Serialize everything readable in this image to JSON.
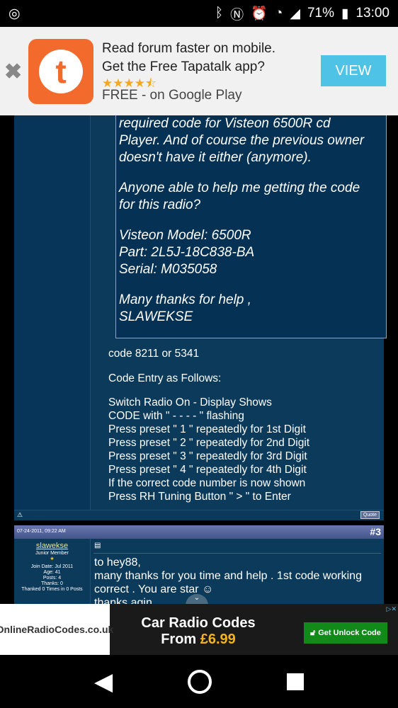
{
  "status": {
    "battery": "71%",
    "time": "13:00",
    "icons": [
      "instagram-icon",
      "bluetooth-icon",
      "nfc-icon",
      "alarm-icon",
      "wifi-icon",
      "signal-icon",
      "battery-icon"
    ]
  },
  "banner": {
    "line1": "Read forum faster on mobile.",
    "line2": "Get the Free Tapatalk app?",
    "rating": "★★★★⯪",
    "line3": "FREE - on Google Play",
    "view": "VIEW",
    "logo": "t"
  },
  "quote": {
    "lines": [
      "required code for Visteon 6500R cd",
      "Player. And of course the previous owner",
      "doesn't have it either (anymore).",
      "",
      "Anyone able to help me getting the code",
      "for this radio?",
      "",
      "Visteon Model: 6500R",
      "Part: 2L5J-18C838-BA",
      "Serial: M035058",
      "",
      "Many thanks for help ,",
      "SLAWEKSE"
    ]
  },
  "reply": {
    "lines": [
      "code 8211 or 5341",
      "",
      "Code Entry as Follows:",
      "",
      "Switch Radio On - Display Shows",
      "CODE with \" - - - - \" flashing",
      "Press preset \" 1 \" repeatedly for 1st Digit",
      "Press preset \" 2 \" repeatedly for 2nd Digit",
      "Press preset \" 3 \" repeatedly for 3rd Digit",
      "Press preset \" 4 \" repeatedly for 4th Digit",
      "If the correct code number is now shown",
      "Press RH Tuning Button \" > \" to Enter"
    ],
    "quote_button": "Quote"
  },
  "post3": {
    "date": "07-24-2011, 09:22 AM",
    "number": "#3",
    "username": "slawekse",
    "rank": "Junior Member",
    "join": "Join Date: Jul 2011",
    "age": "Age: 41",
    "posts": "Posts: 4",
    "thanks": "Thanks: 0",
    "thanked": "Thanked 0 Times in 0 Posts",
    "lines": [
      "to hey88,",
      "many thanks for you time and help . 1st code working",
      "correct . You are star ☺",
      "thanks agin"
    ]
  },
  "ad": {
    "brand": "OnlineRadioCodes.co.uk",
    "headline1": "Car Radio Codes",
    "headline2": "From",
    "price": "£6.99",
    "cta": "Get Unlock Code"
  }
}
